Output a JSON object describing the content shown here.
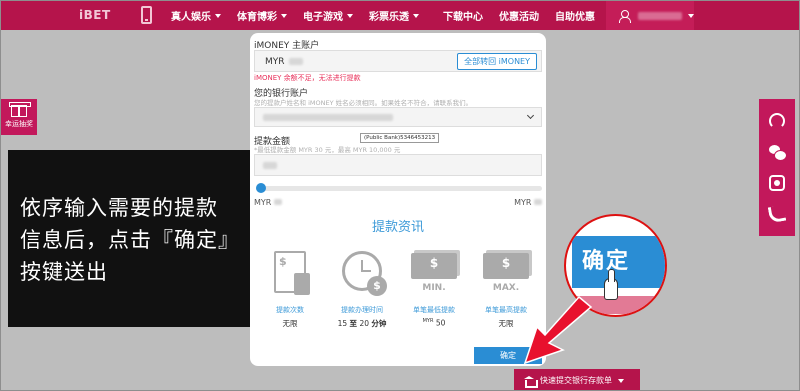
{
  "brand": {
    "logo": "iBET"
  },
  "nav": {
    "items": [
      {
        "label": "真人娱乐"
      },
      {
        "label": "体育博彩"
      },
      {
        "label": "电子游戏"
      },
      {
        "label": "彩票乐透"
      },
      {
        "label": "下载中心"
      },
      {
        "label": "优惠活动"
      },
      {
        "label": "自助优惠"
      }
    ]
  },
  "promo": {
    "label": "幸运抽奖"
  },
  "instruction": {
    "text": "依序输入需要的提款信息后，点击『确定』按键送出"
  },
  "withdraw": {
    "imoney_label": "iMONEY 主账户",
    "imoney_currency": "MYR",
    "transfer_all_label": "全部转回 iMONEY",
    "error_text": "iMONEY 余额不足，无法进行提款",
    "bank_label": "您的银行账户",
    "bank_hint": "您的提款户姓名和 iMONEY 姓名必须相同。如果姓名不符合，请联系我们。",
    "bank_tooltip": "(Public Bank)5346453213",
    "amount_label": "提款金额",
    "amount_hint": "*最低提款金额 MYR 30 元，最高 MYR 10,000 元",
    "min_currency": "MYR",
    "max_currency": "MYR",
    "slider_fraction": 0.0,
    "info_title": "提款资讯",
    "stats": [
      {
        "label": "提款次数",
        "value": "无限"
      },
      {
        "label": "提款办理时间",
        "value_pre": "15",
        "value_mid": "至",
        "value_post": "20",
        "value_unit": "分钟"
      },
      {
        "label": "单笔最低提款",
        "caption": "MIN.",
        "unit": "MYR",
        "value": "50"
      },
      {
        "label": "单笔最高提款",
        "caption": "MAX.",
        "value": "无限"
      }
    ],
    "confirm_label": "确定"
  },
  "callout": {
    "button_label": "确定"
  },
  "bottom_bar": {
    "label": "快速提交银行存款单"
  },
  "colors": {
    "brand": "#b5144b",
    "accent": "#2a8dd4",
    "error": "#e8305a"
  }
}
